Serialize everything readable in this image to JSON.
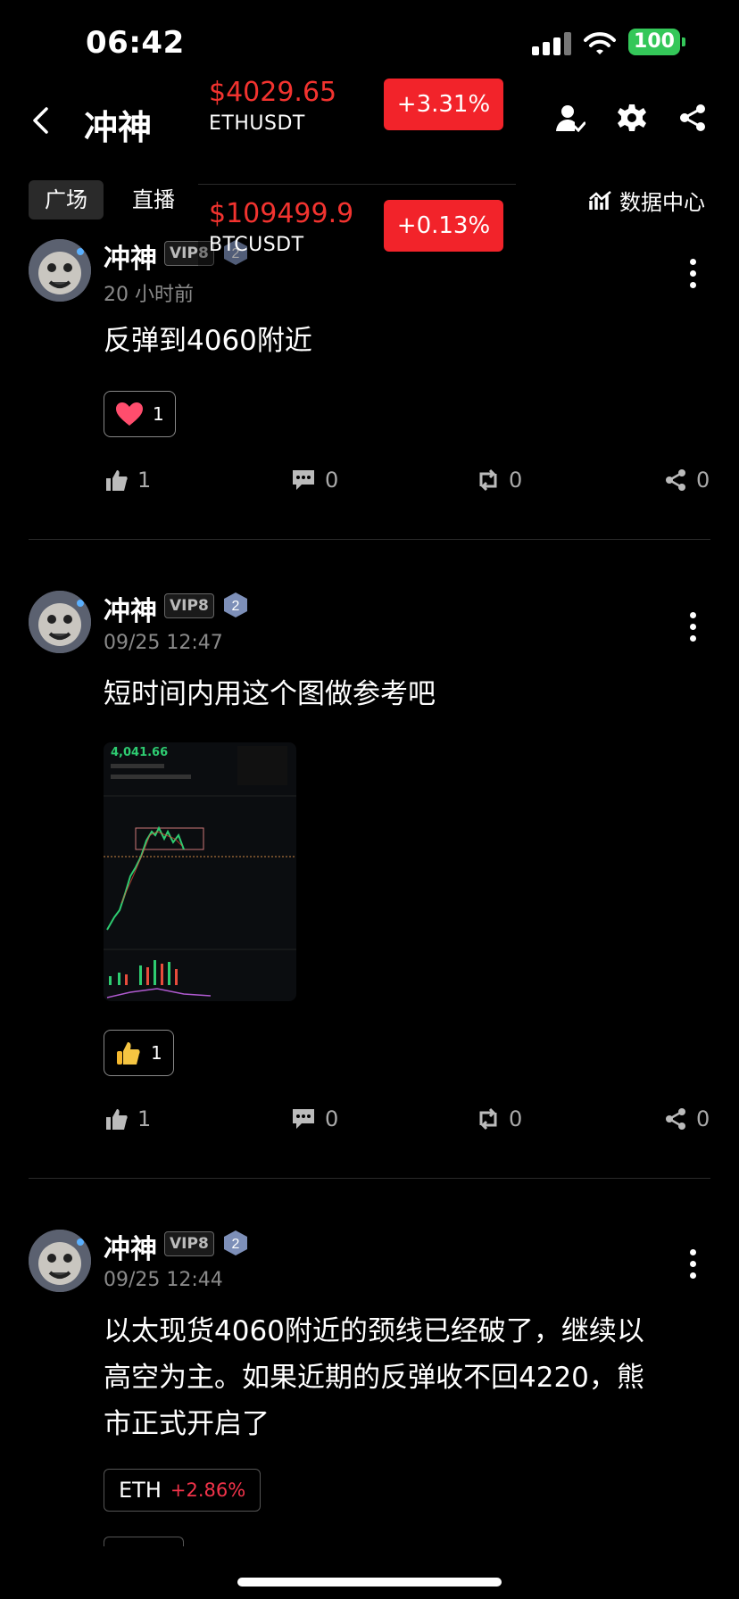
{
  "status": {
    "time": "06:42",
    "battery": "100"
  },
  "header": {
    "title": "冲神"
  },
  "tabs": [
    {
      "label": "广场"
    },
    {
      "label": "直播"
    }
  ],
  "data_center": {
    "label": "数据中心"
  },
  "tickers": [
    {
      "price": "$4029.65",
      "symbol": "ETHUSDT",
      "change": "+3.31%"
    },
    {
      "price": "$109499.9",
      "symbol": "BTCUSDT",
      "change": "+0.13%"
    }
  ],
  "posts": [
    {
      "user": "冲神",
      "vip": "VIP8",
      "level": "2",
      "time": "20 小时前",
      "text": "反弹到4060附近",
      "reaction_count": "1",
      "like": "1",
      "comment": "0",
      "repost": "0",
      "share": "0"
    },
    {
      "user": "冲神",
      "vip": "VIP8",
      "level": "2",
      "time": "09/25 12:47",
      "text": "短时间内用这个图做参考吧",
      "image_price": "4,041.66",
      "reaction_count": "1",
      "like": "1",
      "comment": "0",
      "repost": "0",
      "share": "0"
    },
    {
      "user": "冲神",
      "vip": "VIP8",
      "level": "2",
      "time": "09/25 12:44",
      "text_lines": [
        "以太现货4060附近的颈线已经破了，继续以",
        "高空为主。如果近期的反弹收不回4220，熊",
        "市正式开启了"
      ],
      "tag": {
        "symbol": "ETH",
        "change": "+2.86%"
      }
    }
  ],
  "colors": {
    "up_red": "#f2232a",
    "price_red": "#f2332f",
    "background": "#000000"
  },
  "icons": [
    "back-arrow-icon",
    "user-follow-icon",
    "gear-icon",
    "share-icon",
    "chart-icon",
    "thumb-up-icon",
    "comment-icon",
    "repost-icon",
    "heart-icon",
    "thumbs-up-emoji-icon"
  ]
}
